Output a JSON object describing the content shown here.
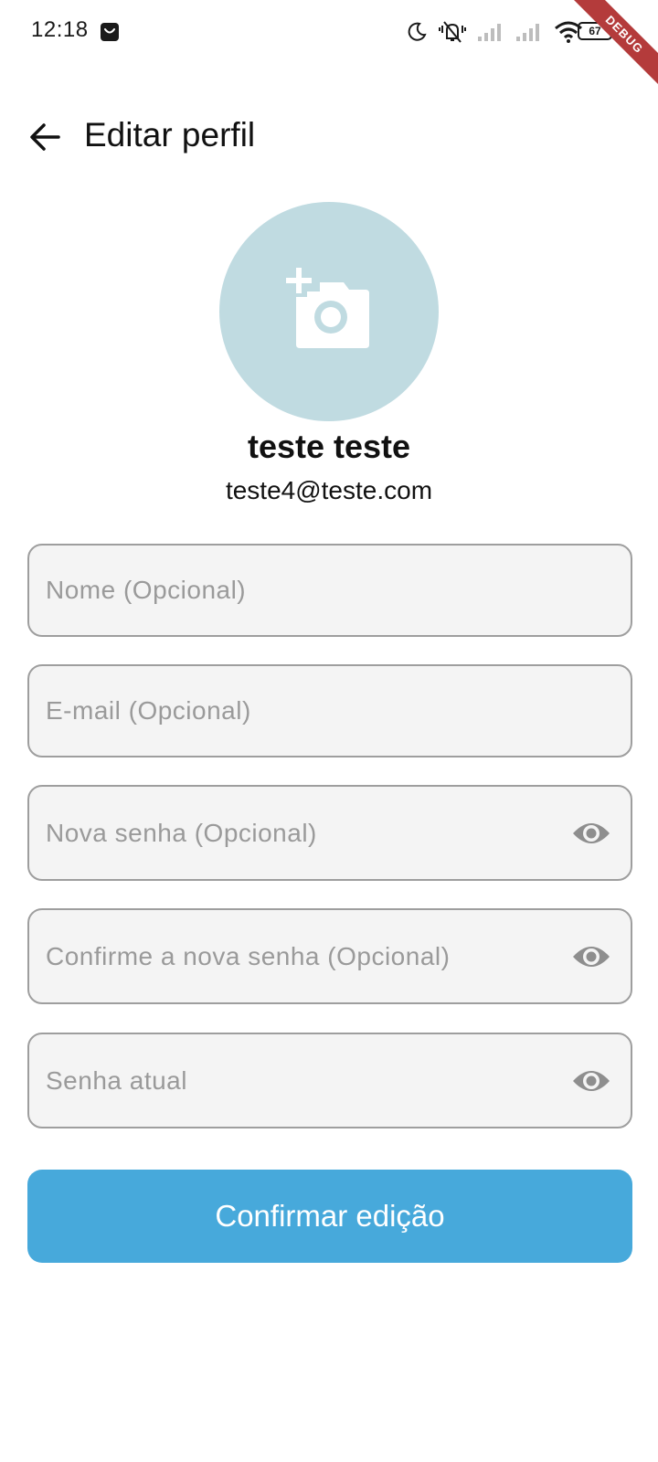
{
  "status_bar": {
    "time": "12:18",
    "battery": "67",
    "icons": [
      "notification-bag-icon",
      "moon-icon",
      "vibrate-off-icon",
      "signal-icon",
      "signal-icon",
      "wifi-icon",
      "battery-icon"
    ]
  },
  "debug_banner": "DEBUG",
  "header": {
    "title": "Editar perfil",
    "back_icon": "arrow-left-icon"
  },
  "profile": {
    "avatar_icon": "add-photo-camera-icon",
    "name": "teste teste",
    "email": "teste4@teste.com"
  },
  "form": {
    "name_placeholder": "Nome (Opcional)",
    "email_placeholder": "E-mail (Opcional)",
    "new_password_placeholder": "Nova senha (Opcional)",
    "confirm_password_placeholder": "Confirme a nova senha (Opcional)",
    "current_password_placeholder": "Senha atual",
    "visibility_icon": "eye-icon"
  },
  "submit_label": "Confirmar edição",
  "colors": {
    "accent": "#47a9db",
    "avatar_bg": "#c0dbe1",
    "field_bg": "#f4f4f4",
    "field_border": "#9e9e9e",
    "placeholder": "#9a9a9a",
    "debug_banner": "#b43b3b"
  }
}
